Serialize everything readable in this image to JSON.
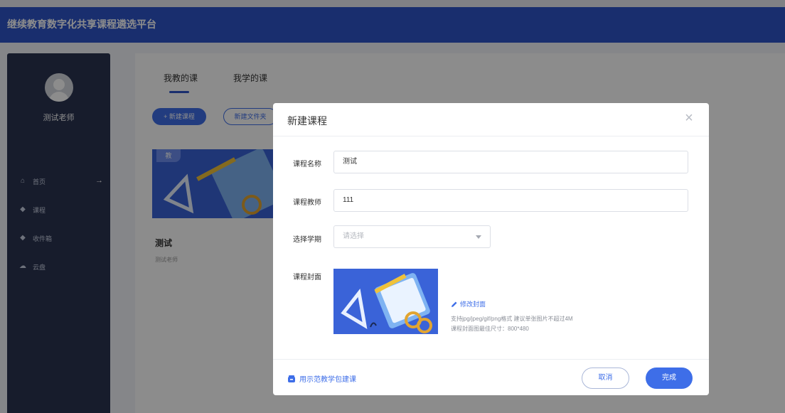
{
  "app": {
    "title": "继续教育数字化共享课程遴选平台"
  },
  "sidebar": {
    "teacher_name": "测试老师",
    "items": [
      {
        "icon": "home-icon",
        "label": "首页",
        "arrow": "→"
      },
      {
        "icon": "course-icon",
        "label": "课程"
      },
      {
        "icon": "inbox-icon",
        "label": "收件箱"
      },
      {
        "icon": "cloud-icon",
        "label": "云盘"
      }
    ]
  },
  "main": {
    "tabs": [
      {
        "label": "我教的课"
      },
      {
        "label": "我学的课"
      }
    ],
    "new_course_label": "+ 新建课程",
    "new_folder_label": "新建文件夹",
    "card": {
      "badge": "教",
      "title": "测试",
      "teacher": "测试老师"
    }
  },
  "modal": {
    "title": "新建课程",
    "close": "×",
    "name": {
      "label": "课程名称",
      "value": "测试"
    },
    "teacher": {
      "label": "课程教师",
      "value": "111"
    },
    "term": {
      "label": "选择学期",
      "placeholder": "请选择"
    },
    "cover": {
      "label": "课程封面",
      "edit_label": "修改封面",
      "hint1": "支持jpg/jpeg/gif/png格式 建议单张图片不超过4M",
      "hint2": "课程封面图最佳尺寸：800*480"
    },
    "footer": {
      "demo_link": "用示范教学包建课",
      "cancel": "取消",
      "done": "完成"
    }
  },
  "colors": {
    "primary": "#3e6ee8",
    "topbar": "#2f55c9",
    "sidebar": "#2a3350"
  }
}
